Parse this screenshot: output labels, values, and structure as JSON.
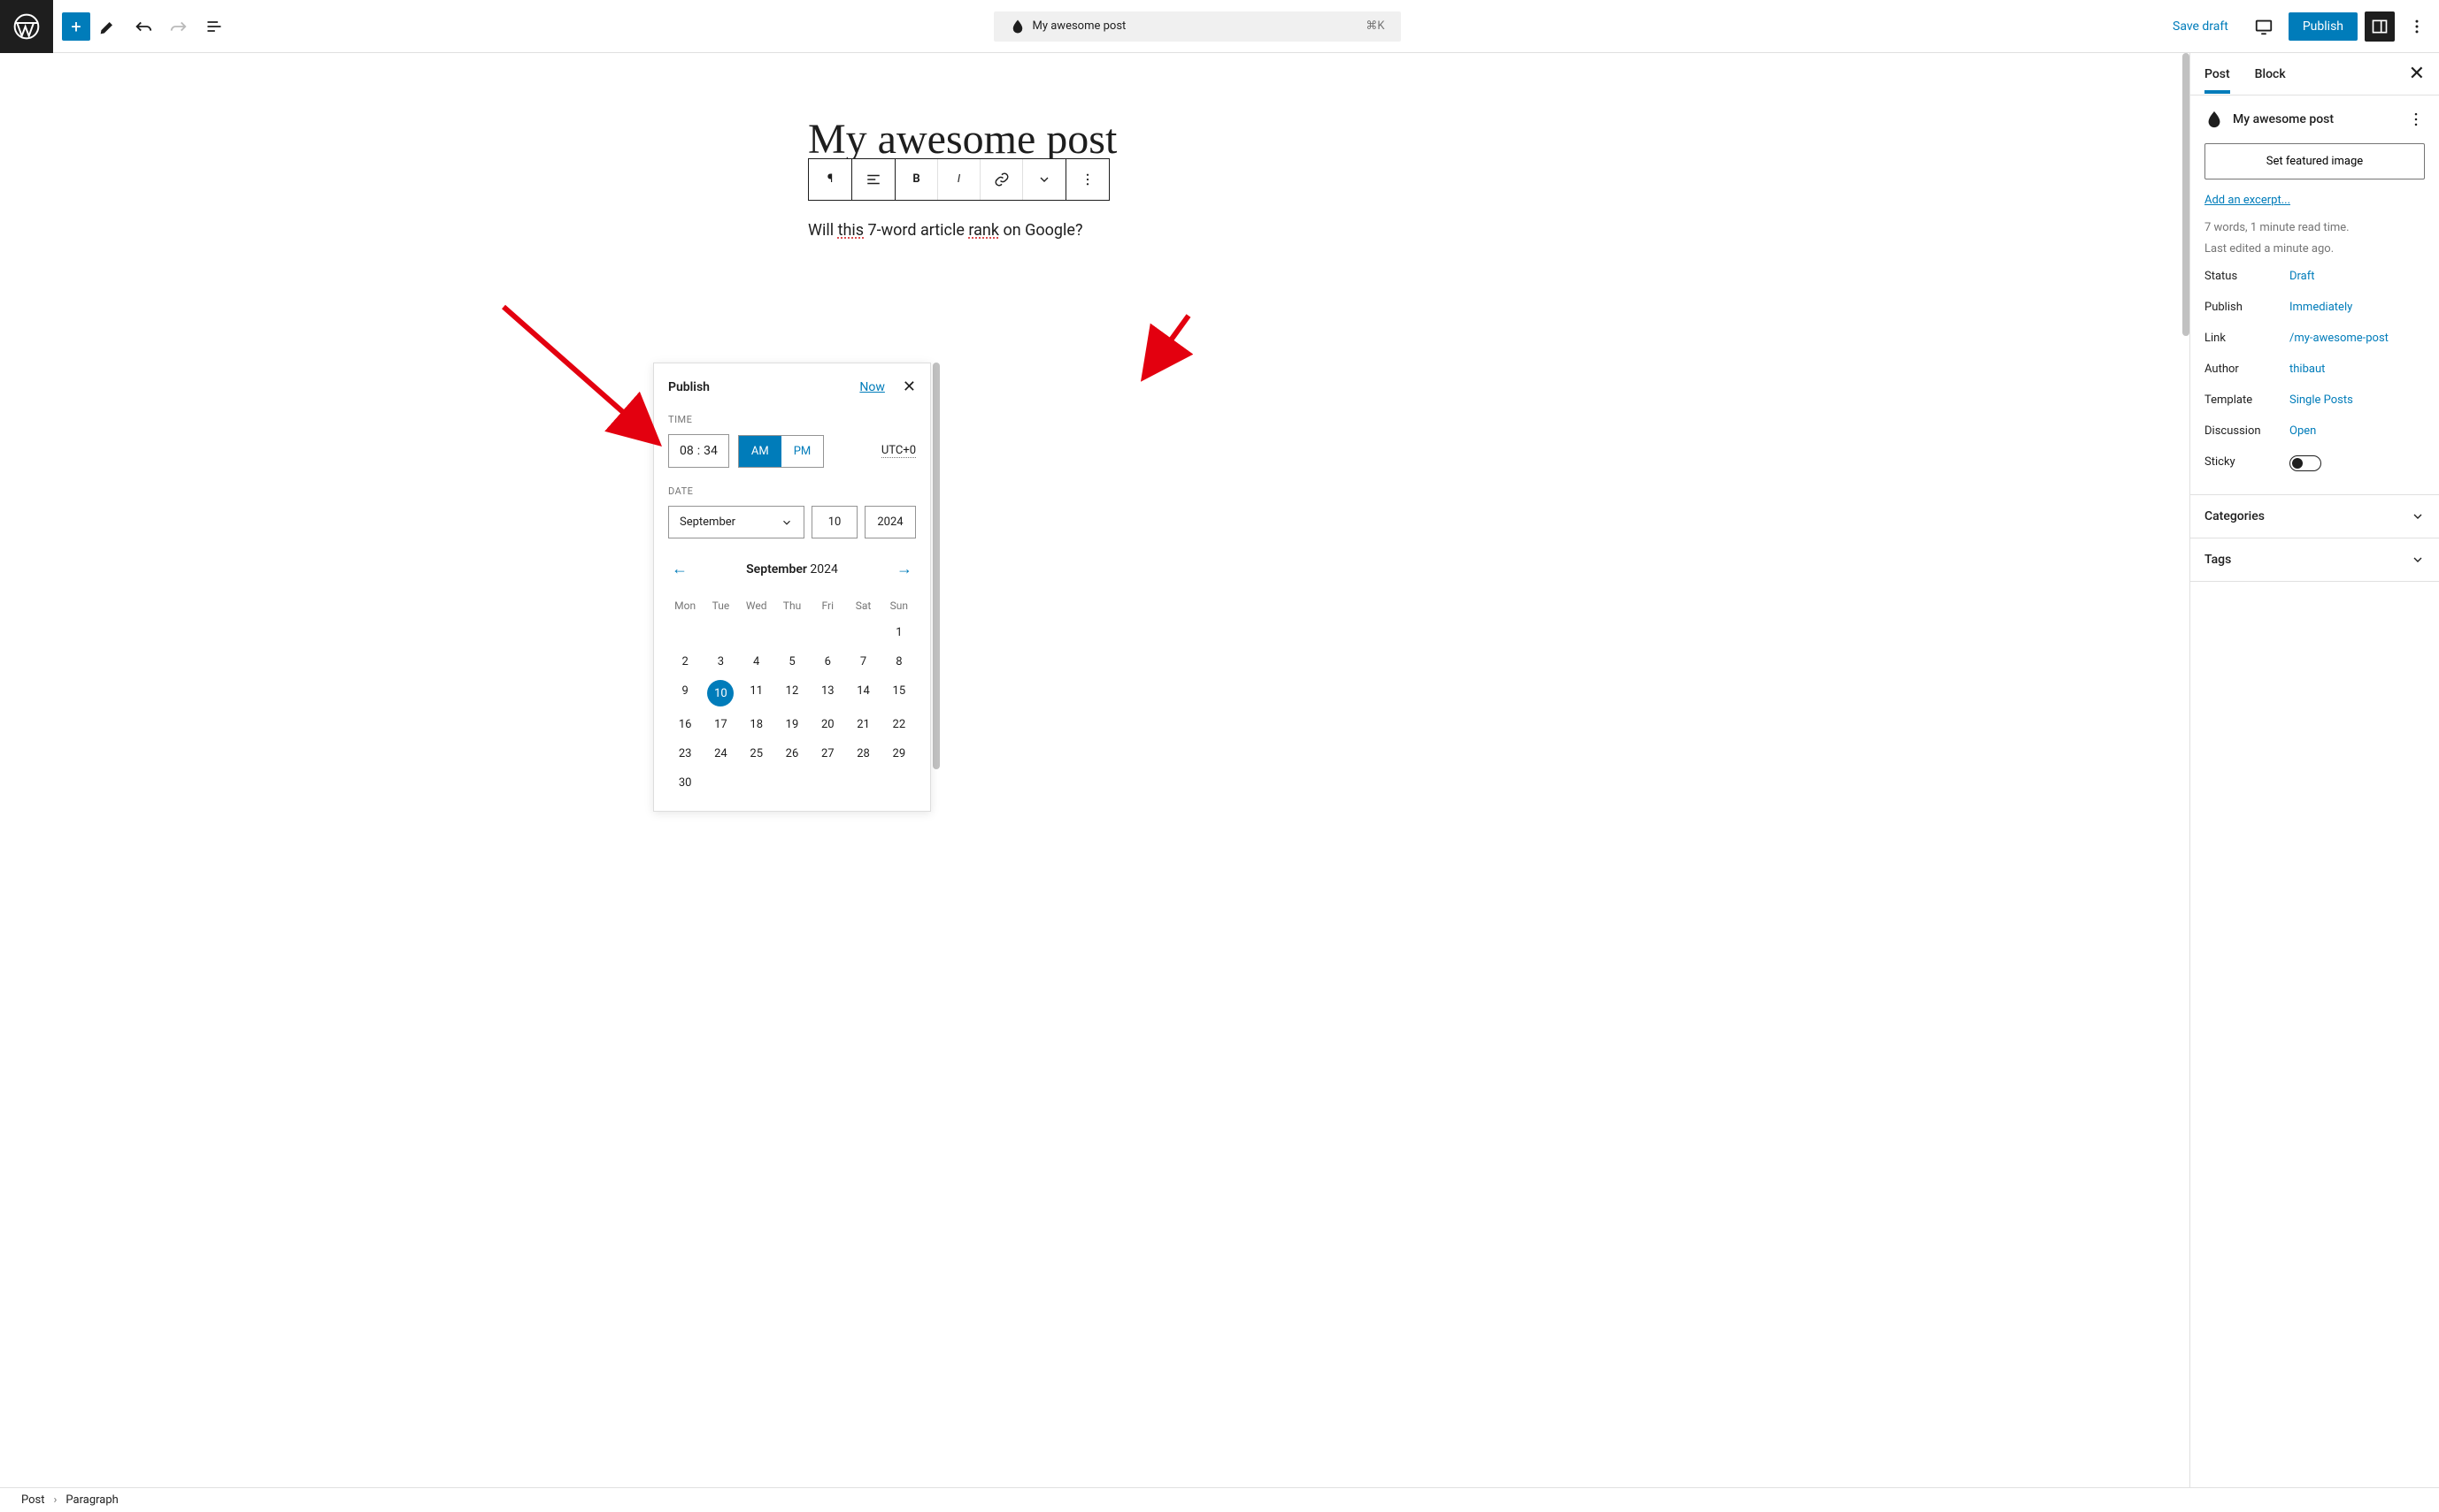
{
  "topbar": {
    "title": "My awesome post",
    "shortcut": "⌘K",
    "save_draft": "Save draft",
    "publish": "Publish"
  },
  "editor": {
    "post_title": "My awesome post",
    "content_prefix": "Will ",
    "content_word1": "this",
    "content_mid": " 7-word article ",
    "content_word2": "rank",
    "content_suffix": " on Google?"
  },
  "sidebar": {
    "tabs": {
      "post": "Post",
      "block": "Block"
    },
    "post_title": "My awesome post",
    "featured_btn": "Set featured image",
    "excerpt_link": "Add an excerpt...",
    "meta1": "7 words, 1 minute read time.",
    "meta2": "Last edited a minute ago.",
    "rows": {
      "status": {
        "label": "Status",
        "value": "Draft"
      },
      "publish": {
        "label": "Publish",
        "value": "Immediately"
      },
      "link": {
        "label": "Link",
        "value": "/my-awesome-post"
      },
      "author": {
        "label": "Author",
        "value": "thibaut"
      },
      "template": {
        "label": "Template",
        "value": "Single Posts"
      },
      "discussion": {
        "label": "Discussion",
        "value": "Open"
      },
      "sticky": {
        "label": "Sticky"
      }
    },
    "categories": "Categories",
    "tags": "Tags"
  },
  "popover": {
    "title": "Publish",
    "now": "Now",
    "time_label": "TIME",
    "hour": "08",
    "minute": "34",
    "am": "AM",
    "pm": "PM",
    "tz": "UTC+0",
    "date_label": "DATE",
    "month": "September",
    "day": "10",
    "year": "2024",
    "cal_month": "September",
    "cal_year": "2024",
    "dows": [
      "Mon",
      "Tue",
      "Wed",
      "Thu",
      "Fri",
      "Sat",
      "Sun"
    ],
    "selected_day": 10,
    "first_day_col": 6,
    "days_in_month": 30
  },
  "footer": {
    "crumb1": "Post",
    "crumb2": "Paragraph"
  }
}
